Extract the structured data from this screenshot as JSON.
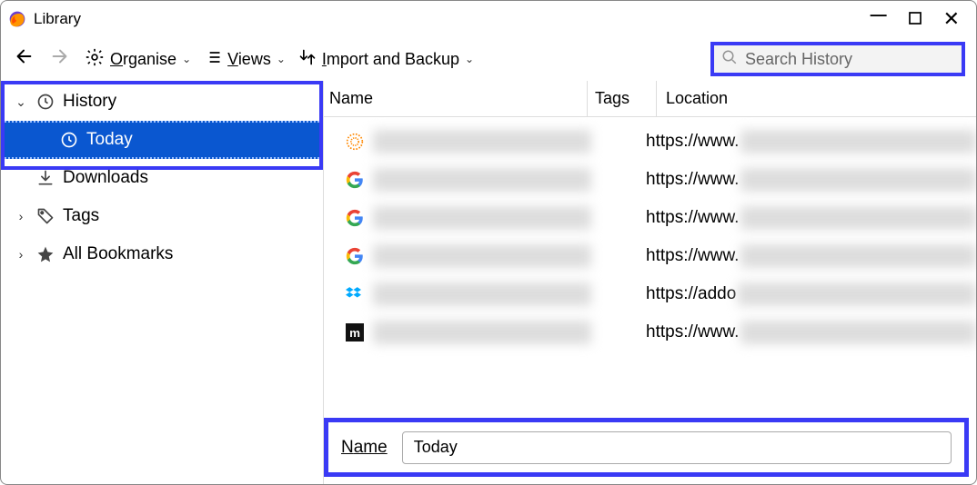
{
  "window": {
    "title": "Library"
  },
  "toolbar": {
    "organise": "Organise",
    "views": "Views",
    "import_backup": "Import and Backup"
  },
  "search": {
    "placeholder": "Search History"
  },
  "sidebar": {
    "history": {
      "label": "History",
      "expanded": true
    },
    "today": {
      "label": "Today",
      "selected": true
    },
    "downloads": {
      "label": "Downloads"
    },
    "tags": {
      "label": "Tags",
      "expanded": false
    },
    "all_bookmarks": {
      "label": "All Bookmarks",
      "expanded": false
    }
  },
  "columns": {
    "name": "Name",
    "tags": "Tags",
    "location": "Location"
  },
  "rows": [
    {
      "icon": "thomson-reuters",
      "location_prefix": "https://www."
    },
    {
      "icon": "google",
      "location_prefix": "https://www."
    },
    {
      "icon": "google",
      "location_prefix": "https://www."
    },
    {
      "icon": "google",
      "location_prefix": "https://www."
    },
    {
      "icon": "dropbox",
      "location_prefix": "https://addo"
    },
    {
      "icon": "m-icon",
      "location_prefix": "https://www."
    }
  ],
  "details": {
    "name_label": "Name",
    "name_value": "Today"
  }
}
